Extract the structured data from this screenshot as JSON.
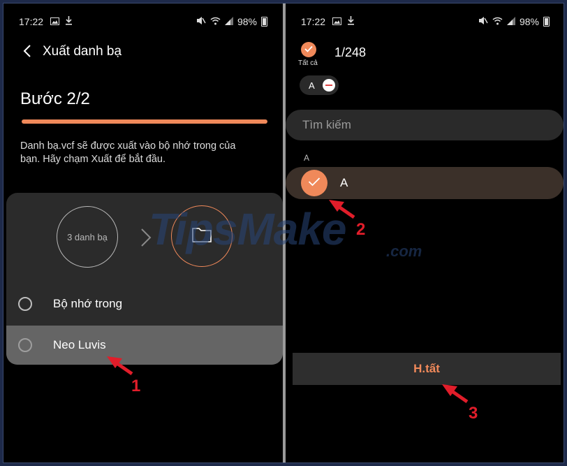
{
  "left": {
    "status": {
      "time": "17:22",
      "battery": "98%"
    },
    "title": "Xuất danh bạ",
    "step": "Bước 2/2",
    "progress": 1.0,
    "description": "Danh bạ.vcf sẽ được xuất vào bộ nhớ trong của bạn. Hãy chạm Xuất để bắt đầu.",
    "contacts_count": "3 danh bạ",
    "options": [
      {
        "label": "Bộ nhớ trong"
      },
      {
        "label": "Neo Luvis"
      }
    ]
  },
  "right": {
    "status": {
      "time": "17:22",
      "battery": "98%"
    },
    "select_all_label": "Tất cả",
    "count": "1/248",
    "chip_label": "A",
    "search_placeholder": "Tìm kiếm",
    "section_header": "A",
    "contact_name": "A",
    "done_label": "H.tất"
  },
  "watermark": {
    "main": "TipsMake",
    "sub": ".com"
  },
  "annotations": [
    "1",
    "2",
    "3"
  ],
  "colors": {
    "accent": "#f0895a",
    "arrow": "#e11d2a",
    "background": "#000000"
  },
  "icons": [
    "back-arrow-icon",
    "chevron-right-icon",
    "folder-icon",
    "check-icon",
    "image-icon",
    "download-icon",
    "mute-icon",
    "wifi-icon",
    "signal-icon",
    "battery-icon"
  ]
}
